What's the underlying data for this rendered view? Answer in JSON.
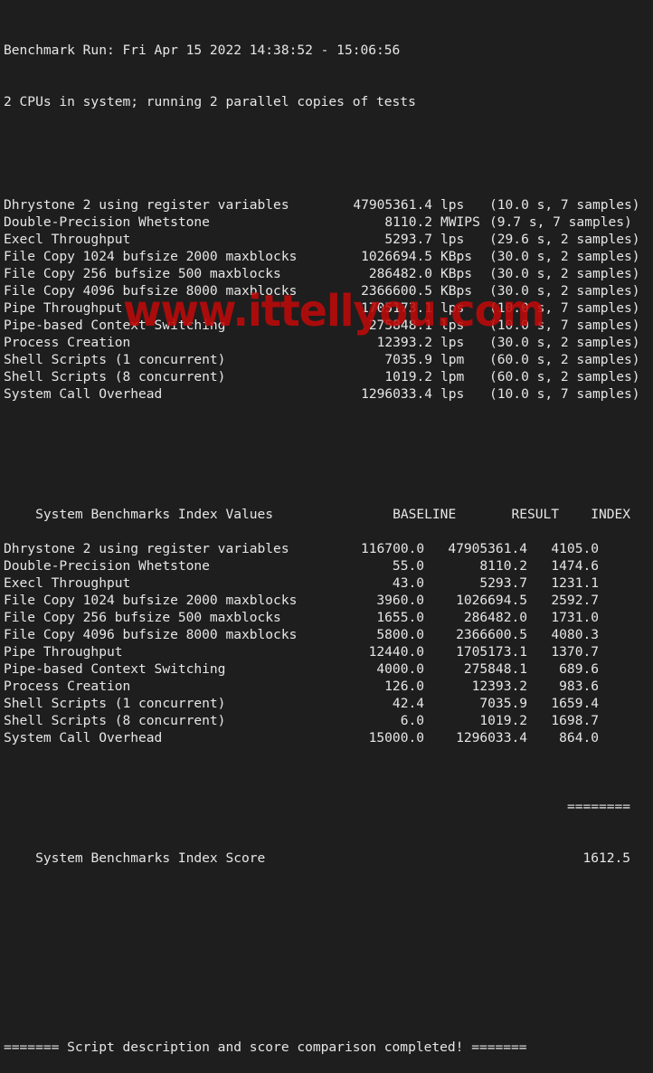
{
  "header": {
    "run_line": "Benchmark Run: Fri Apr 15 2022 14:38:52 - 15:06:56",
    "cpu_line": "2 CPUs in system; running 2 parallel copies of tests"
  },
  "raw_results": [
    {
      "name": "Dhrystone 2 using register variables",
      "value": "47905361.4",
      "unit": "lps",
      "detail": "(10.0 s, 7 samples)"
    },
    {
      "name": "Double-Precision Whetstone",
      "value": "8110.2",
      "unit": "MWIPS",
      "detail": "(9.7 s, 7 samples)"
    },
    {
      "name": "Execl Throughput",
      "value": "5293.7",
      "unit": "lps",
      "detail": "(29.6 s, 2 samples)"
    },
    {
      "name": "File Copy 1024 bufsize 2000 maxblocks",
      "value": "1026694.5",
      "unit": "KBps",
      "detail": "(30.0 s, 2 samples)"
    },
    {
      "name": "File Copy 256 bufsize 500 maxblocks",
      "value": "286482.0",
      "unit": "KBps",
      "detail": "(30.0 s, 2 samples)"
    },
    {
      "name": "File Copy 4096 bufsize 8000 maxblocks",
      "value": "2366600.5",
      "unit": "KBps",
      "detail": "(30.0 s, 2 samples)"
    },
    {
      "name": "Pipe Throughput",
      "value": "1705173.1",
      "unit": "lps",
      "detail": "(10.0 s, 7 samples)"
    },
    {
      "name": "Pipe-based Context Switching",
      "value": "275848.1",
      "unit": "lps",
      "detail": "(10.0 s, 7 samples)"
    },
    {
      "name": "Process Creation",
      "value": "12393.2",
      "unit": "lps",
      "detail": "(30.0 s, 2 samples)"
    },
    {
      "name": "Shell Scripts (1 concurrent)",
      "value": "7035.9",
      "unit": "lpm",
      "detail": "(60.0 s, 2 samples)"
    },
    {
      "name": "Shell Scripts (8 concurrent)",
      "value": "1019.2",
      "unit": "lpm",
      "detail": "(60.0 s, 2 samples)"
    },
    {
      "name": "System Call Overhead",
      "value": "1296033.4",
      "unit": "lps",
      "detail": "(10.0 s, 7 samples)"
    }
  ],
  "index_table": {
    "title": "System Benchmarks Index Values",
    "columns": [
      "BASELINE",
      "RESULT",
      "INDEX"
    ],
    "rows": [
      {
        "name": "Dhrystone 2 using register variables",
        "baseline": "116700.0",
        "result": "47905361.4",
        "index": "4105.0"
      },
      {
        "name": "Double-Precision Whetstone",
        "baseline": "55.0",
        "result": "8110.2",
        "index": "1474.6"
      },
      {
        "name": "Execl Throughput",
        "baseline": "43.0",
        "result": "5293.7",
        "index": "1231.1"
      },
      {
        "name": "File Copy 1024 bufsize 2000 maxblocks",
        "baseline": "3960.0",
        "result": "1026694.5",
        "index": "2592.7"
      },
      {
        "name": "File Copy 256 bufsize 500 maxblocks",
        "baseline": "1655.0",
        "result": "286482.0",
        "index": "1731.0"
      },
      {
        "name": "File Copy 4096 bufsize 8000 maxblocks",
        "baseline": "5800.0",
        "result": "2366600.5",
        "index": "4080.3"
      },
      {
        "name": "Pipe Throughput",
        "baseline": "12440.0",
        "result": "1705173.1",
        "index": "1370.7"
      },
      {
        "name": "Pipe-based Context Switching",
        "baseline": "4000.0",
        "result": "275848.1",
        "index": "689.6"
      },
      {
        "name": "Process Creation",
        "baseline": "126.0",
        "result": "12393.2",
        "index": "983.6"
      },
      {
        "name": "Shell Scripts (1 concurrent)",
        "baseline": "42.4",
        "result": "7035.9",
        "index": "1659.4"
      },
      {
        "name": "Shell Scripts (8 concurrent)",
        "baseline": "6.0",
        "result": "1019.2",
        "index": "1698.7"
      },
      {
        "name": "System Call Overhead",
        "baseline": "15000.0",
        "result": "1296033.4",
        "index": "864.0"
      }
    ],
    "separator": "========",
    "score_label": "System Benchmarks Index Score",
    "score_value": "1612.5"
  },
  "footer": {
    "completed_line": "======= Script description and score comparison completed! ======="
  },
  "watermark": {
    "text": "www.ittellyou.com",
    "color": "#be0a0a"
  }
}
